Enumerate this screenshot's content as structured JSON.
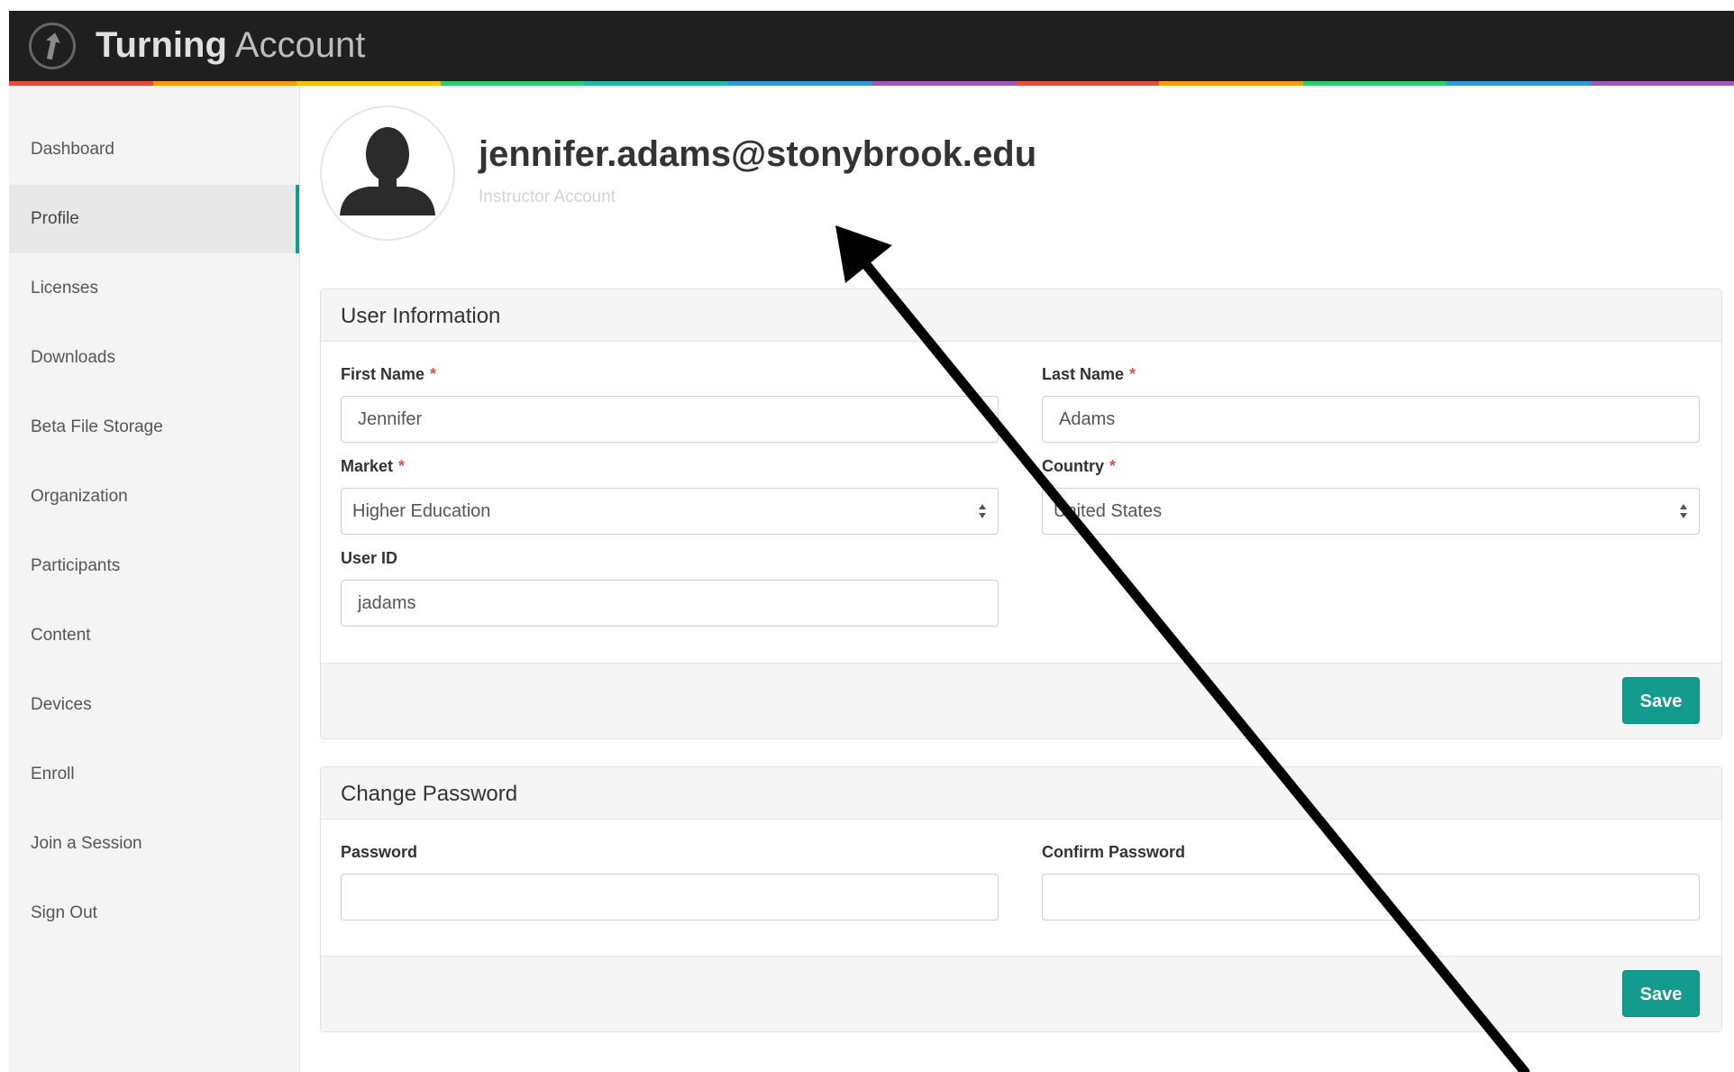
{
  "app": {
    "brand_bold": "Turning",
    "brand_light": "Account"
  },
  "sidebar": {
    "items": [
      {
        "label": "Dashboard"
      },
      {
        "label": "Profile"
      },
      {
        "label": "Licenses"
      },
      {
        "label": "Downloads"
      },
      {
        "label": "Beta File Storage"
      },
      {
        "label": "Organization"
      },
      {
        "label": "Participants"
      },
      {
        "label": "Content"
      },
      {
        "label": "Devices"
      },
      {
        "label": "Enroll"
      },
      {
        "label": "Join a Session"
      },
      {
        "label": "Sign Out"
      }
    ],
    "active": "Profile"
  },
  "profile": {
    "email": "jennifer.adams@stonybrook.edu",
    "account_type": "Instructor Account",
    "avatar_icon": "user-silhouette-icon"
  },
  "user_info": {
    "title": "User Information",
    "first_name": {
      "label": "First Name",
      "required_mark": "*",
      "value": "Jennifer"
    },
    "last_name": {
      "label": "Last Name",
      "required_mark": "*",
      "value": "Adams"
    },
    "market": {
      "label": "Market",
      "required_mark": "*",
      "value": "Higher Education"
    },
    "country": {
      "label": "Country",
      "required_mark": "*",
      "value": "United States"
    },
    "user_id": {
      "label": "User ID",
      "value": "jadams"
    },
    "save_label": "Save"
  },
  "change_password": {
    "title": "Change Password",
    "password": {
      "label": "Password",
      "value": ""
    },
    "confirm_password": {
      "label": "Confirm Password",
      "value": ""
    },
    "save_label": "Save"
  },
  "colors": {
    "topbar": "#1f1f1f",
    "accent": "#139b8d",
    "required": "#d9534f",
    "stripe": [
      "#e74c3c",
      "#f39c12",
      "#f1c40f",
      "#2ecc71",
      "#1abc9c",
      "#3498db",
      "#9b59b6",
      "#e74c3c",
      "#f39c12",
      "#2ecc71",
      "#3498db",
      "#9b59b6"
    ]
  },
  "annotation": {
    "icon": "pointer-arrow-annotation"
  }
}
